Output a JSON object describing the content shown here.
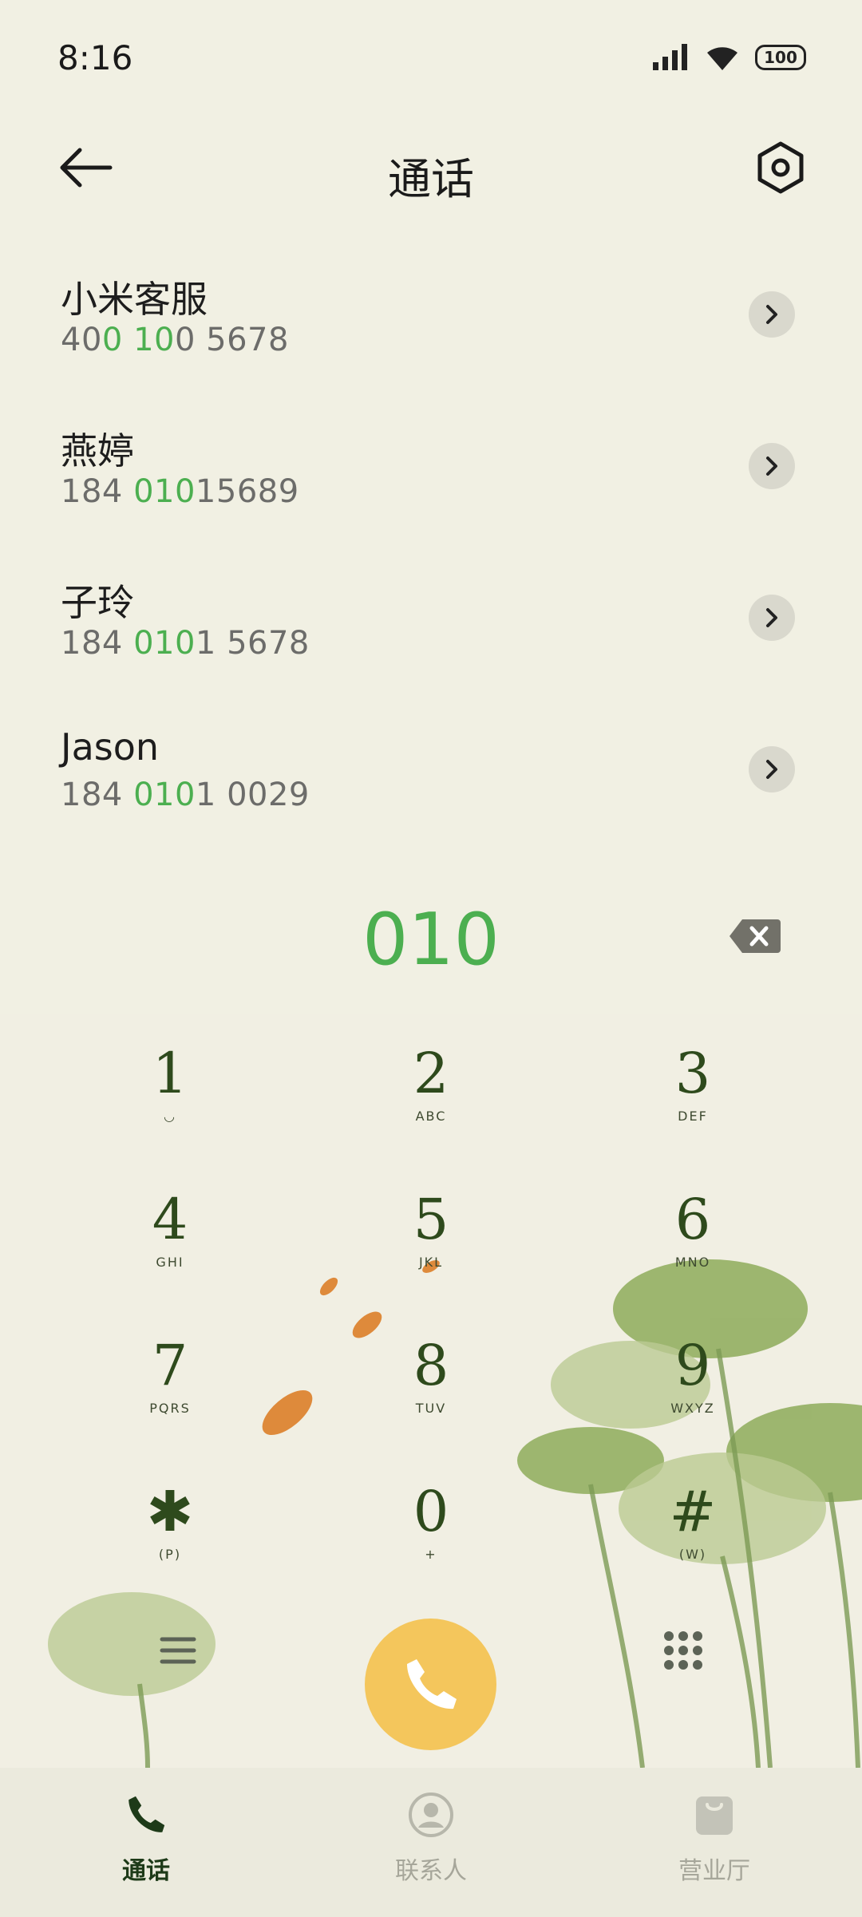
{
  "status_bar": {
    "time": "8:16",
    "battery": "100"
  },
  "header": {
    "title": "通话"
  },
  "contacts": [
    {
      "name": "小米客服",
      "number_parts": [
        "40",
        "0",
        " ",
        "10",
        "0 5678"
      ]
    },
    {
      "name": "燕婷",
      "number_parts": [
        "184 ",
        "010",
        "15689"
      ]
    },
    {
      "name": "子玲",
      "number_parts": [
        "184 ",
        "010",
        "1 5678"
      ]
    },
    {
      "name": "Jason",
      "number_parts": [
        "184 ",
        "010",
        "1 0029"
      ]
    }
  ],
  "dial_input": "010",
  "keypad": [
    {
      "digit": "1",
      "letters": "◡"
    },
    {
      "digit": "2",
      "letters": "ABC"
    },
    {
      "digit": "3",
      "letters": "DEF"
    },
    {
      "digit": "4",
      "letters": "GHI"
    },
    {
      "digit": "5",
      "letters": "JKL"
    },
    {
      "digit": "6",
      "letters": "MNO"
    },
    {
      "digit": "7",
      "letters": "PQRS"
    },
    {
      "digit": "8",
      "letters": "TUV"
    },
    {
      "digit": "9",
      "letters": "WXYZ"
    },
    {
      "digit": "✱",
      "letters": "(P)"
    },
    {
      "digit": "0",
      "letters": "+"
    },
    {
      "digit": "#",
      "letters": "(W)"
    }
  ],
  "bottom_nav": [
    {
      "label": "通话",
      "icon": "phone-icon",
      "active": true
    },
    {
      "label": "联系人",
      "icon": "contacts-icon",
      "active": false
    },
    {
      "label": "营业厅",
      "icon": "shop-bag-icon",
      "active": false
    }
  ],
  "colors": {
    "background": "#f1f0e3",
    "highlight": "#4caf50",
    "call_button": "#f4c65c",
    "keypad_text": "#2e4a1c"
  }
}
